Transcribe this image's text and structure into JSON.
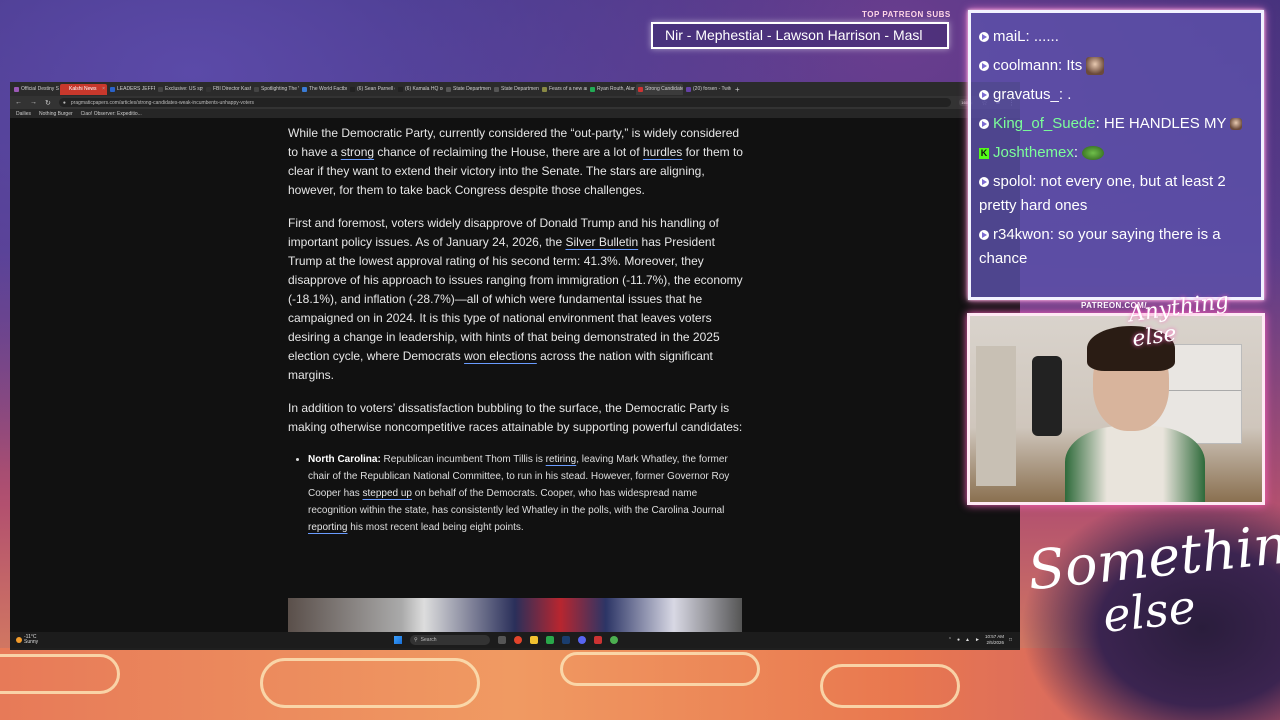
{
  "overlay": {
    "subs_label": "TOP PATREON SUBS",
    "subs_ticker": "Nir - Mephestial - Lawson Harrison - Masl",
    "patreon_label": "PATREON.COM/",
    "brand_small": "Anything else",
    "brand_line1": "Something",
    "brand_line2": "else"
  },
  "browser": {
    "tabs": [
      {
        "label": "Official Destiny Sub"
      },
      {
        "label": "Kalshi News"
      },
      {
        "label": "LEADERS JEFFRIES"
      },
      {
        "label": "Exclusive: US spy c"
      },
      {
        "label": "FBI Director Kash P"
      },
      {
        "label": "Spotlighting The W"
      },
      {
        "label": "The World Factboo"
      },
      {
        "label": "(6) Sean Parnell on"
      },
      {
        "label": "(6) Kamala HQ on"
      },
      {
        "label": "State Department"
      },
      {
        "label": "State Department -"
      },
      {
        "label": "Fears of a new arm"
      },
      {
        "label": "Ryan Routh, Alan E"
      },
      {
        "label": "Strong Candidates"
      },
      {
        "label": "(20) forsen - Twitch"
      }
    ],
    "url": "pragmaticpapers.com/articles/strong-candidates-weak-incumbents-unhappy-voters",
    "zoom": "160%",
    "bookmarks": [
      "Dailies",
      "Nothing Burger",
      "Ciao! Observer: Expeditio..."
    ]
  },
  "article": {
    "p1_a": "While the Democratic Party, currently considered the “out-party,” is widely considered to have a ",
    "p1_link1": "strong",
    "p1_b": " chance of reclaiming the House, there are a lot of ",
    "p1_link2": "hurdles",
    "p1_c": " for them to clear if they want to extend their victory into the Senate. The stars are aligning, however, for them to take back Congress despite those challenges.",
    "p2_a": "First and foremost, voters widely disapprove of Donald Trump and his handling of important policy issues. As of January 24, 2026, the ",
    "p2_link1": "Silver Bulletin",
    "p2_b": " has President Trump at the lowest approval rating of his second term: 41.3%. Moreover, they disapprove of his approach to issues ranging from immigration (-11.7%), the economy (-18.1%), and inflation (-28.7%)—all of which were fundamental issues that he campaigned on in 2024. It is this type of national environment that leaves voters desiring a change in leadership, with hints of that being demonstrated in the 2025 election cycle, where Democrats ",
    "p2_link2": "won elections",
    "p2_c": " across the nation with significant margins.",
    "p3": "In addition to voters’ dissatisfaction bubbling to the surface, the Democratic Party is making otherwise noncompetitive races attainable by supporting powerful candidates:",
    "li_bold": "North Carolina:",
    "li_a": " Republican incumbent Thom Tillis is ",
    "li_link1": "retiring",
    "li_b": ", leaving Mark Whatley, the former chair of the Republican National Committee, to run in his stead. However, former Governor Roy Cooper has ",
    "li_link2": "stepped up",
    "li_c": " on behalf of the Democrats. Cooper, who has widespread name recognition within the state, has consistently led Whatley in the polls, with the Carolina Journal ",
    "li_link3": "reporting",
    "li_d": " his most recent lead being eight points."
  },
  "taskbar": {
    "temp": "-11°C",
    "weather": "Sunny",
    "search": "Search",
    "time": "10:57 AM",
    "date": "2/5/2026"
  },
  "chat": [
    {
      "user": "maiL",
      "text": ": ......",
      "type": "twitch"
    },
    {
      "user": "coolmann",
      "text": ": Its ",
      "type": "twitch",
      "emote": "biden-emote"
    },
    {
      "user": "gravatus_:",
      "text": " .",
      "type": "twitch"
    },
    {
      "user": "King_of_Suede",
      "text": ": HE HANDLES MY ",
      "type": "twitch",
      "emote": "small-emote",
      "color": "#7cff9a"
    },
    {
      "user": "Joshthemex",
      "text": ": ",
      "type": "kick",
      "emote": "frog-emote"
    },
    {
      "user": "spolol",
      "text": ": not every one, but at least 2 pretty hard ones",
      "type": "twitch"
    },
    {
      "user": "r34kwon",
      "text": ": so your saying there is a chance",
      "type": "twitch",
      "emote_before": "face-emote"
    }
  ]
}
